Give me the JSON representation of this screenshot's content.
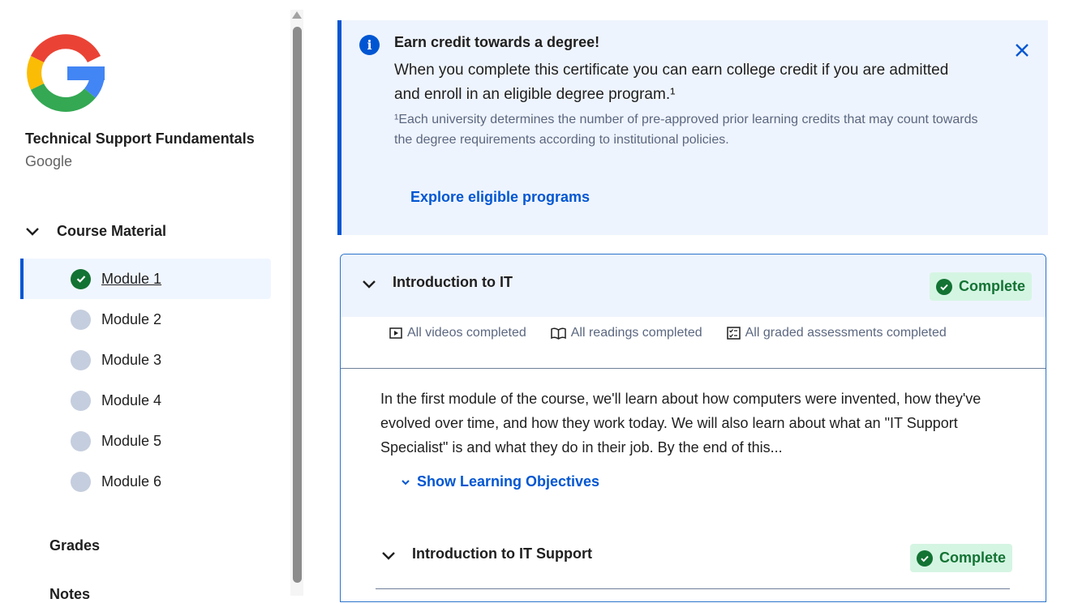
{
  "sidebar": {
    "course_title": "Technical Support Fundamentals",
    "course_org": "Google",
    "course_material_label": "Course Material",
    "modules": [
      {
        "label": "Module 1",
        "status": "complete",
        "active": true
      },
      {
        "label": "Module 2",
        "status": "incomplete",
        "active": false
      },
      {
        "label": "Module 3",
        "status": "incomplete",
        "active": false
      },
      {
        "label": "Module 4",
        "status": "incomplete",
        "active": false
      },
      {
        "label": "Module 5",
        "status": "incomplete",
        "active": false
      },
      {
        "label": "Module 6",
        "status": "incomplete",
        "active": false
      }
    ],
    "grades_label": "Grades",
    "notes_label": "Notes"
  },
  "banner": {
    "title": "Earn credit towards a degree!",
    "body": "When you complete this certificate you can earn college credit if you are admitted and enroll in an eligible degree program.¹",
    "footnote": "¹Each university determines the number of pre-approved prior learning credits that may count towards the degree requirements according to institutional policies.",
    "link": "Explore eligible programs"
  },
  "module": {
    "title": "Introduction to IT",
    "status": "Complete",
    "stats": {
      "videos": "All videos completed",
      "readings": "All readings completed",
      "assessments": "All graded assessments completed"
    },
    "description": "In the first module of the course, we'll learn about how computers were invented, how they've evolved over time, and how they work today. We will also learn about what an \"IT Support Specialist\" is and what they do in their job. By the end of this...",
    "show_objectives": "Show Learning Objectives",
    "lesson": {
      "title": "Introduction to IT Support",
      "status": "Complete"
    }
  },
  "colors": {
    "accent": "#0056d2",
    "success": "#137333",
    "success_bg": "#d5f5e3",
    "banner_bg": "#eef4fd"
  }
}
